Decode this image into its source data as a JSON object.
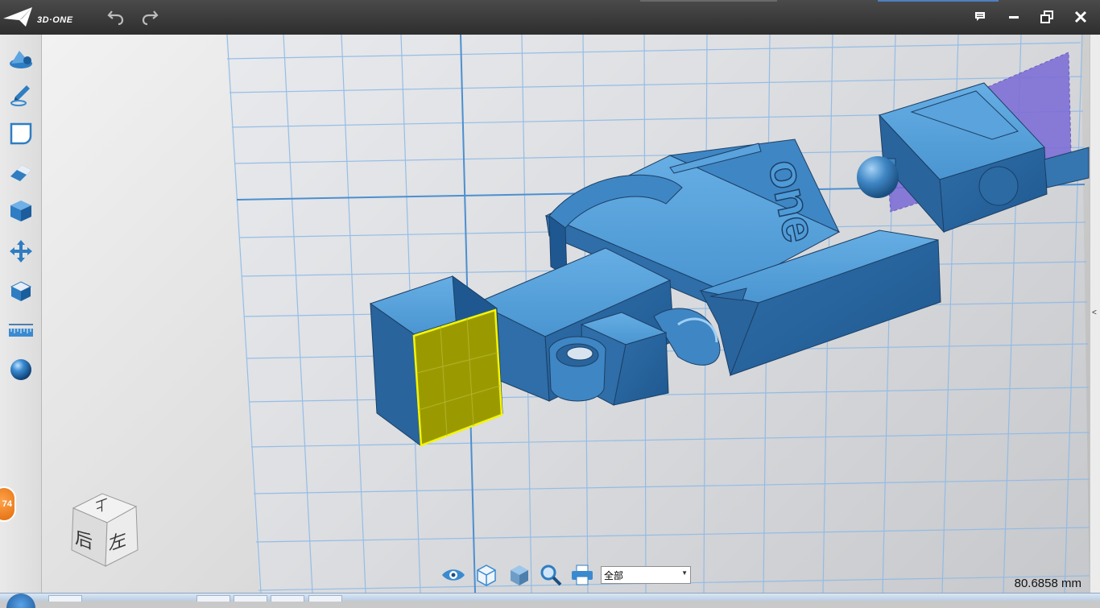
{
  "app": {
    "logo_text": "3D·ONE"
  },
  "titlebar": {
    "undo": "undo-icon",
    "redo": "redo-icon",
    "window_controls": [
      "comment-icon",
      "minimize-icon",
      "restore-icon",
      "close-icon"
    ]
  },
  "left_tools": [
    "basic-shapes-icon",
    "sketch-pen-icon",
    "sketch-edit-icon",
    "special-features-icon",
    "feature-modeling-icon",
    "move-icon",
    "assembly-icon",
    "measure-ruler-icon",
    "color-sphere-icon"
  ],
  "badge": {
    "text": "74"
  },
  "viewport": {
    "model_text": "one",
    "viewcube": {
      "top_face": "上",
      "left_face": "后",
      "front_face": "左"
    }
  },
  "bottom_toolbar": {
    "icons": [
      "view-eye-icon",
      "wireframe-cube-icon",
      "shaded-cube-icon",
      "zoom-icon",
      "print-icon"
    ],
    "filter": {
      "selected": "全部"
    }
  },
  "status": {
    "measurement": "80.6858 mm"
  },
  "colors": {
    "model_blue": "#3f86c4",
    "selected_face": "#9a9a00",
    "selected_edge": "#f5f500",
    "plane_purple": "#7a6ad6",
    "grid_line": "#8fb9e6"
  }
}
